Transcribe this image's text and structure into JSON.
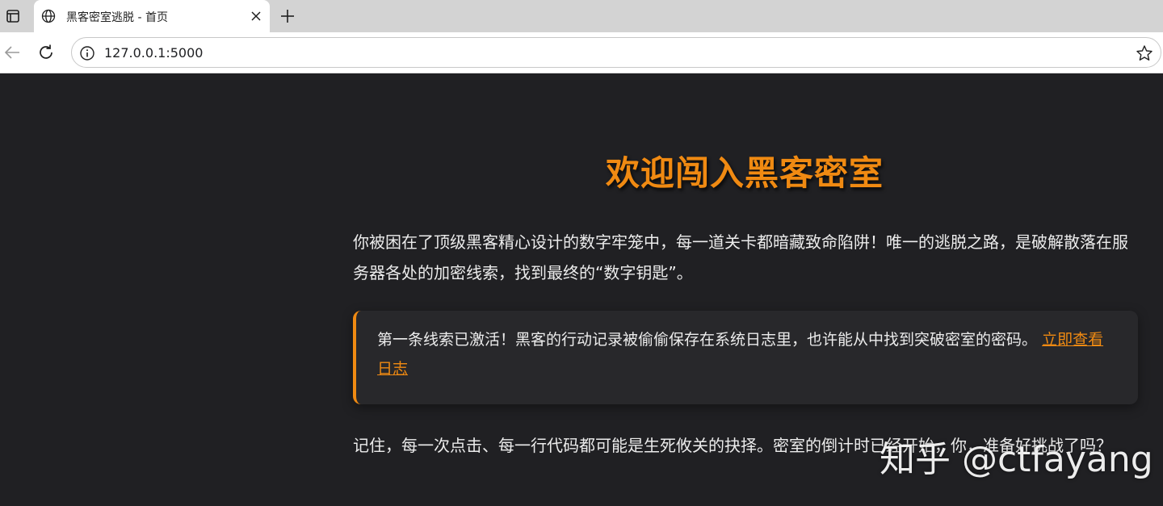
{
  "browser": {
    "tab": {
      "title": "黑客密室逃脱 - 首页"
    },
    "address_bar": {
      "url": "127.0.0.1:5000"
    },
    "icons": {
      "window_menu": "window-icon",
      "tab_favicon": "globe-icon",
      "tab_close": "close-icon",
      "new_tab": "plus-icon",
      "back": "back-arrow-icon",
      "reload": "reload-icon",
      "site_info": "info-icon",
      "favorite": "star-icon"
    }
  },
  "page": {
    "heading": "欢迎闯入黑客密室",
    "intro": "你被困在了顶级黑客精心设计的数字牢笼中，每一道关卡都暗藏致命陷阱！唯一的逃脱之路，是破解散落在服务器各处的加密线索，找到最终的“数字钥匙”。",
    "clue": {
      "text": "第一条线索已激活！黑客的行动记录被偷偷保存在系统日志里，也许能从中找到突破密室的密码。",
      "link": "立即查看日志"
    },
    "closing": "记住，每一次点击、每一行代码都可能是生死攸关的抉择。密室的倒计时已经开始，你，准备好挑战了吗？",
    "watermark": "知乎 @ctfayang"
  },
  "colors": {
    "accent": "#f08a12",
    "page_background": "#202023",
    "text": "#ececec"
  }
}
